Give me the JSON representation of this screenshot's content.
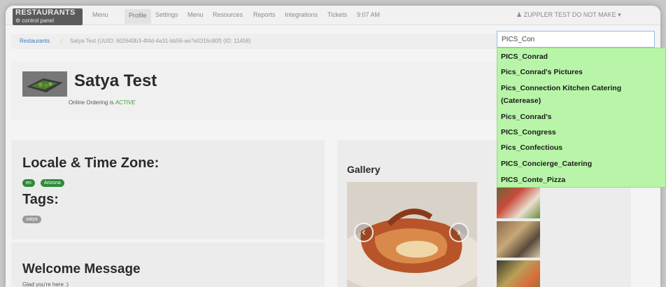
{
  "nav": {
    "brand_line1": "RESTAURANTS",
    "brand_line2": "control panel",
    "items": [
      "Menu",
      "Profile",
      "Settings",
      "Menu",
      "Resources",
      "Reports",
      "Integrations",
      "Tickets"
    ],
    "time": "9:07 AM",
    "user": "ZUPPLER TEST DO NOT MAKE"
  },
  "breadcrumb": {
    "root": "Restaurants",
    "separator": "/",
    "current": "Satya Test (UUID: 602640b3-4f4d-4a31-bb56-ae7e0316c80f) (ID: 11458)"
  },
  "restaurant": {
    "name": "Satya Test",
    "ordering_prefix": "Online Ordering is",
    "ordering_status": "ACTIVE"
  },
  "locale": {
    "heading": "Locale & Time Zone:",
    "badges": [
      "en",
      "Arizona"
    ],
    "tags_heading": "Tags:",
    "tags": [
      "satya"
    ]
  },
  "welcome": {
    "heading": "Welcome Message",
    "text": "Glad you're here :)"
  },
  "gallery": {
    "heading": "Gallery"
  },
  "search": {
    "value": "PICS_Con",
    "suggestions": [
      "PICS_Conrad",
      "Pics_Conrad's Pictures",
      "Pics_Connection Kitchen Catering",
      "(Caterease)",
      "Pics_Conrad's",
      "PICS_Congress",
      "Pics_Confectious",
      "PICS_Concierge_Catering",
      "PICS_Conte_Pizza"
    ]
  },
  "colors": {
    "dropdown_bg": "#b8f5a8",
    "badge_green": "#2f8a3a",
    "link_blue": "#3a7bc8",
    "active_green": "#3aa03a"
  }
}
